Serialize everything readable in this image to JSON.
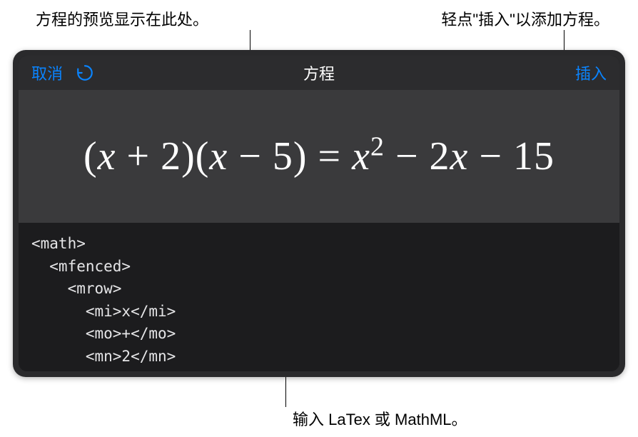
{
  "callouts": {
    "preview": "方程的预览显示在此处。",
    "insert": "轻点\"插入\"以添加方程。",
    "input": "输入 LaTex 或 MathML。"
  },
  "nav": {
    "cancel": "取消",
    "title": "方程",
    "insert": "插入"
  },
  "equation": {
    "display_html": "(<span class='var'>x</span> + 2)(<span class='var'>x</span> − 5) = <span class='var'>x</span><sup>2</sup> − 2<span class='var'>x</span> − 15"
  },
  "code": "<math>\n  <mfenced>\n    <mrow>\n      <mi>x</mi>\n      <mo>+</mo>\n      <mn>2</mn>"
}
